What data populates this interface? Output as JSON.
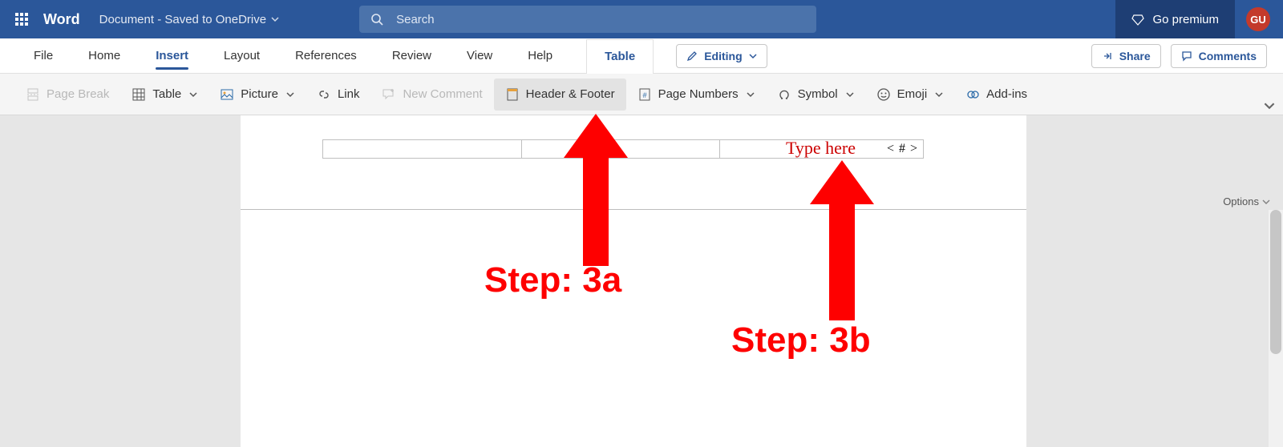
{
  "titlebar": {
    "app_name": "Word",
    "doc_status": "Document - Saved to OneDrive",
    "search_placeholder": "Search",
    "premium_label": "Go premium",
    "user_initials": "GU"
  },
  "tabs": {
    "items": [
      "File",
      "Home",
      "Insert",
      "Layout",
      "References",
      "Review",
      "View",
      "Help"
    ],
    "selected_index": 2,
    "context_tab": "Table",
    "editing_label": "Editing",
    "share_label": "Share",
    "comments_label": "Comments"
  },
  "ribbon": {
    "page_break": "Page Break",
    "table": "Table",
    "picture": "Picture",
    "link": "Link",
    "new_comment": "New Comment",
    "header_footer": "Header & Footer",
    "page_numbers": "Page Numbers",
    "symbol": "Symbol",
    "emoji": "Emoji",
    "addins": "Add-ins"
  },
  "document": {
    "header_page_num_display": "< # >",
    "options_label": "Options"
  },
  "annotations": {
    "type_here": "Type here",
    "step_a": "Step: 3a",
    "step_b": "Step: 3b"
  }
}
